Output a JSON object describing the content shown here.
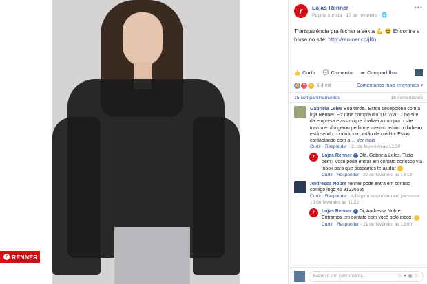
{
  "photo": {
    "brand_badge": "RENNER"
  },
  "post": {
    "page_name": "Lojas Renner",
    "meta": "Página curtida · 17 de fevereiro · ",
    "text_main": "Transparência pra fechar a sexta ",
    "text_tail": " Encontre a blusa no site: ",
    "link": "http://ren-ner.co/jKn"
  },
  "actions": {
    "like": "Curtir",
    "comment": "Comentar",
    "share": "Compartilhar"
  },
  "reactions": {
    "count": "1,4 mil",
    "sort": "Comentários mais relevantes"
  },
  "stats": {
    "shares": "15 compartilhamentos",
    "comments": "16 comentários"
  },
  "comments": [
    {
      "name": "Gabriela Leles",
      "text": "Boa tarde.. Estou decepciona com a loja Renner. Fiz uma compra dia 11/02/2017 no site da empresa e assim que finalizei a compra o site travou e não gerou pedido e mesmo assim o dinheiro está sendo cobrado do cartão de crédito. Estou contactando com a ...",
      "more": "Ver mais",
      "meta_links": "Curtir · Responder",
      "meta_date": " · 21 de fevereiro às 13:50",
      "reply": {
        "name": "Lojas Renner",
        "text": "Olá, Gabriela Leles. Tudo bem? Você pode entrar em contato conosco via inbox para que possamos te ajudar",
        "meta_links": "Curtir · Responder",
        "meta_date": " · 22 de fevereiro às 14:13"
      }
    },
    {
      "name": "Andressa Nobre",
      "text": "renner pode entra em contato comigo logo 45 91236665",
      "meta_links": "Curtir · Responder",
      "meta_date": " · A Página respondeu em particular · 18 de fevereiro às 01:22",
      "reply": {
        "name": "Lojas Renner",
        "text": "Oi, Andressa Nobre. Entramos em contato com você pelo inbox.",
        "meta_links": "Curtir · Responder",
        "meta_date": " · 21 de fevereiro às 13:00"
      }
    }
  ],
  "composer": {
    "placeholder": "Escreva um comentário..."
  }
}
